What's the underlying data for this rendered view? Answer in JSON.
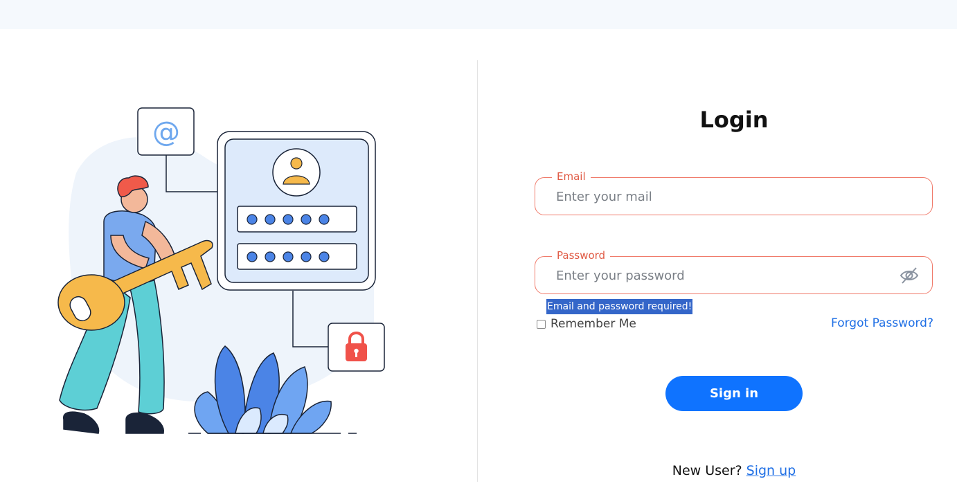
{
  "login": {
    "title": "Login",
    "email": {
      "label": "Email",
      "placeholder": "Enter your mail",
      "value": ""
    },
    "password": {
      "label": "Password",
      "placeholder": "Enter your password",
      "value": "",
      "toggle_icon": "eye-off-icon"
    },
    "error_message": "Email and password required!",
    "remember_label": "Remember Me",
    "remember_checked": false,
    "forgot_label": "Forgot Password?",
    "submit_label": "Sign in",
    "signup_prompt": "New User?",
    "signup_link": "Sign up"
  },
  "illustration": {
    "icons": [
      "at-sign-icon",
      "user-avatar-icon",
      "padlock-icon",
      "key-icon"
    ]
  },
  "colors": {
    "accent": "#0f73ff",
    "error_border": "#f07a6a",
    "error_label": "#e05a44",
    "link": "#1f6fe5",
    "error_highlight": "#3466c9"
  }
}
